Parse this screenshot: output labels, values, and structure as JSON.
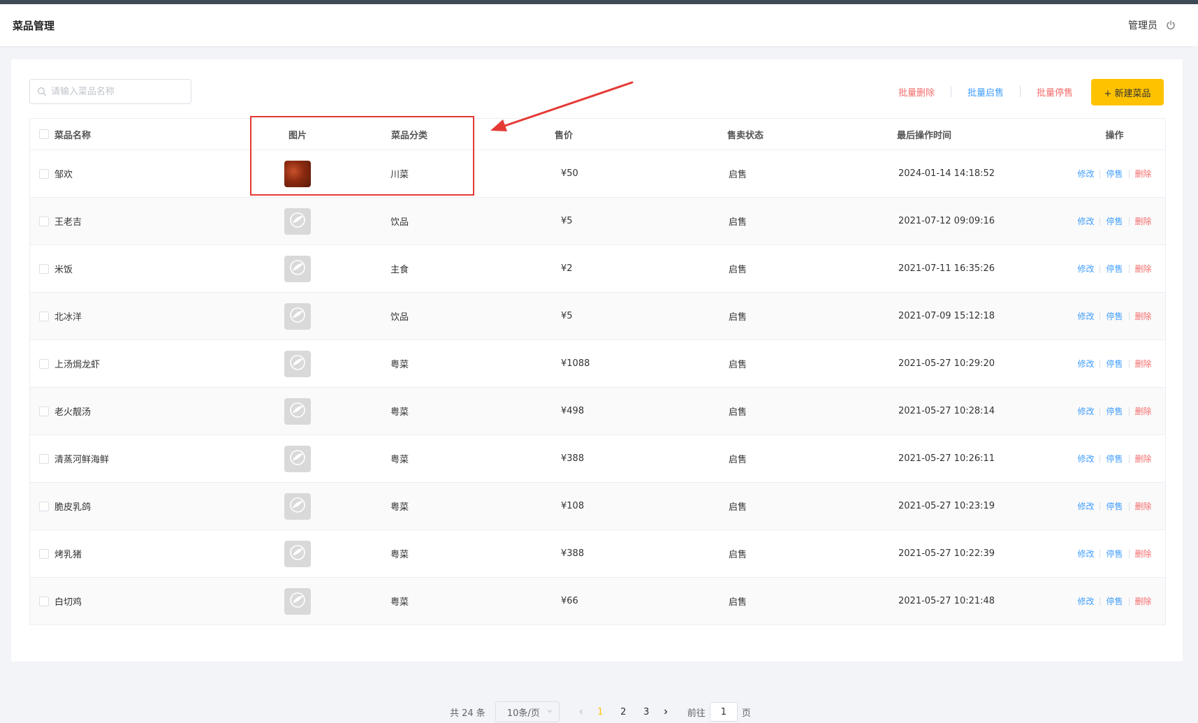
{
  "header": {
    "title": "菜品管理",
    "user": "管理员"
  },
  "toolbar": {
    "search_placeholder": "请输入菜品名称",
    "batch_delete": "批量删除",
    "batch_enable": "批量启售",
    "batch_disable": "批量停售",
    "add_button": "+ 新建菜品"
  },
  "table": {
    "headers": {
      "name": "菜品名称",
      "image": "图片",
      "category": "菜品分类",
      "price": "售价",
      "status": "售卖状态",
      "time": "最后操作时间",
      "ops": "操作"
    },
    "op_labels": {
      "edit": "修改",
      "stop": "停售",
      "delete": "删除"
    },
    "rows": [
      {
        "name": "邹欢",
        "category": "川菜",
        "price": "¥50",
        "status": "启售",
        "time": "2024-01-14 14:18:52"
      },
      {
        "name": "王老吉",
        "category": "饮品",
        "price": "¥5",
        "status": "启售",
        "time": "2021-07-12 09:09:16"
      },
      {
        "name": "米饭",
        "category": "主食",
        "price": "¥2",
        "status": "启售",
        "time": "2021-07-11 16:35:26"
      },
      {
        "name": "北冰洋",
        "category": "饮品",
        "price": "¥5",
        "status": "启售",
        "time": "2021-07-09 15:12:18"
      },
      {
        "name": "上汤焗龙虾",
        "category": "粤菜",
        "price": "¥1088",
        "status": "启售",
        "time": "2021-05-27 10:29:20"
      },
      {
        "name": "老火靓汤",
        "category": "粤菜",
        "price": "¥498",
        "status": "启售",
        "time": "2021-05-27 10:28:14"
      },
      {
        "name": "清蒸河鲜海鲜",
        "category": "粤菜",
        "price": "¥388",
        "status": "启售",
        "time": "2021-05-27 10:26:11"
      },
      {
        "name": "脆皮乳鸽",
        "category": "粤菜",
        "price": "¥108",
        "status": "启售",
        "time": "2021-05-27 10:23:19"
      },
      {
        "name": "烤乳猪",
        "category": "粤菜",
        "price": "¥388",
        "status": "启售",
        "time": "2021-05-27 10:22:39"
      },
      {
        "name": "白切鸡",
        "category": "粤菜",
        "price": "¥66",
        "status": "启售",
        "time": "2021-05-27 10:21:48"
      }
    ]
  },
  "pagination": {
    "total": "共 24 条",
    "page_size": "10条/页",
    "pages": [
      "1",
      "2",
      "3"
    ],
    "current": "1",
    "goto_label": "前往",
    "goto_value": "1",
    "page_suffix": "页"
  },
  "colors": {
    "accent": "#ffc200",
    "link_blue": "#419eff",
    "danger_red": "#f56c6c",
    "annotation_red": "#e53935",
    "topbar": "#3f4a57"
  },
  "icons": {
    "search": "search-icon",
    "power": "power-icon",
    "thumb_placeholder": "leaf-placeholder-icon"
  }
}
